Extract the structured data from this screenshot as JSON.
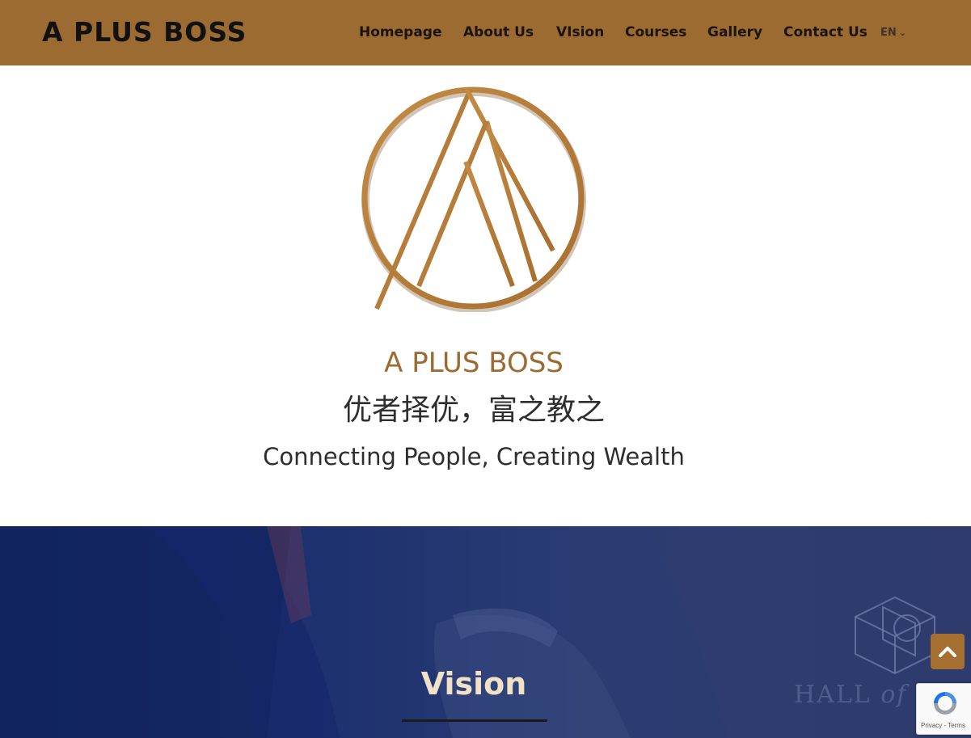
{
  "header": {
    "brand": "A PLUS BOSS",
    "nav": [
      {
        "label": "Homepage"
      },
      {
        "label": "About Us"
      },
      {
        "label": "VIsion"
      },
      {
        "label": "Courses"
      },
      {
        "label": "Gallery"
      },
      {
        "label": "Contact Us"
      }
    ],
    "language": "EN"
  },
  "hero": {
    "logo_icon": "a-plus-boss-circle-a-logo",
    "title": "A PLUS BOSS",
    "chinese_slogan": "优者择优，富之教之",
    "tagline": "Connecting People, Creating Wealth"
  },
  "vision": {
    "title": "Vision",
    "watermark_icon": "hexagon-cube-icon",
    "watermark_text_main": "HALL",
    "watermark_text_italic": "of"
  },
  "widgets": {
    "scroll_top_icon": "chevron-up-icon",
    "recaptcha_links": "Privacy - Terms"
  },
  "colors": {
    "brand_gold": "#9b6b31",
    "vision_navy": "#1e3270",
    "vision_title": "#f1e1c6"
  }
}
